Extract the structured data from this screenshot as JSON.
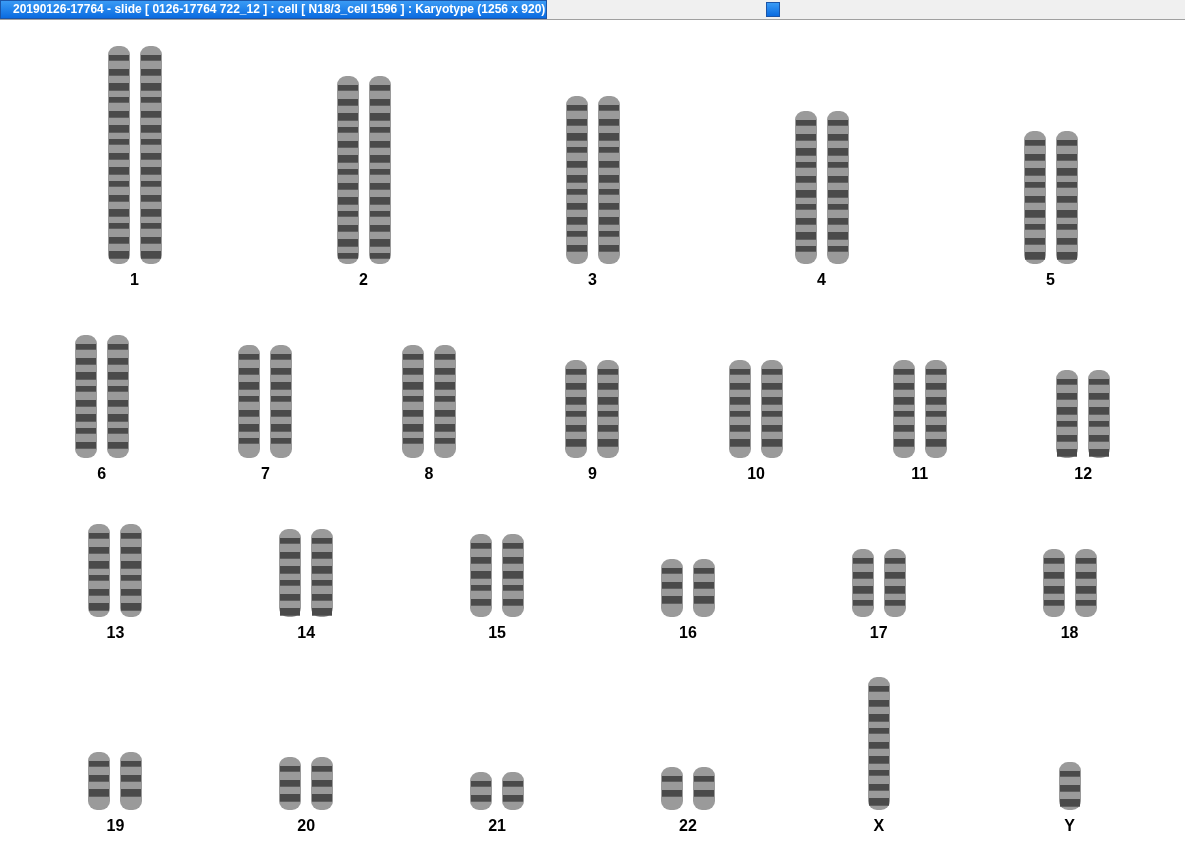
{
  "window": {
    "title": "20190126-17764 - slide [ 0126-17764 722_12 ] : cell [ N18/3_cell 1596 ] : Karyotype  (1256 x 920)"
  },
  "karyogram": {
    "rows": [
      [
        {
          "label": "1"
        },
        {
          "label": "2"
        },
        {
          "label": "3"
        },
        {
          "label": "4"
        },
        {
          "label": "5"
        }
      ],
      [
        {
          "label": "6"
        },
        {
          "label": "7"
        },
        {
          "label": "8"
        },
        {
          "label": "9"
        },
        {
          "label": "10"
        },
        {
          "label": "11"
        },
        {
          "label": "12"
        }
      ],
      [
        {
          "label": "13"
        },
        {
          "label": "14"
        },
        {
          "label": "15"
        },
        {
          "label": "16"
        },
        {
          "label": "17"
        },
        {
          "label": "18"
        }
      ],
      [
        {
          "label": "19"
        },
        {
          "label": "20"
        },
        {
          "label": "21"
        },
        {
          "label": "22"
        },
        {
          "label": "X"
        },
        {
          "label": "Y"
        }
      ]
    ]
  }
}
